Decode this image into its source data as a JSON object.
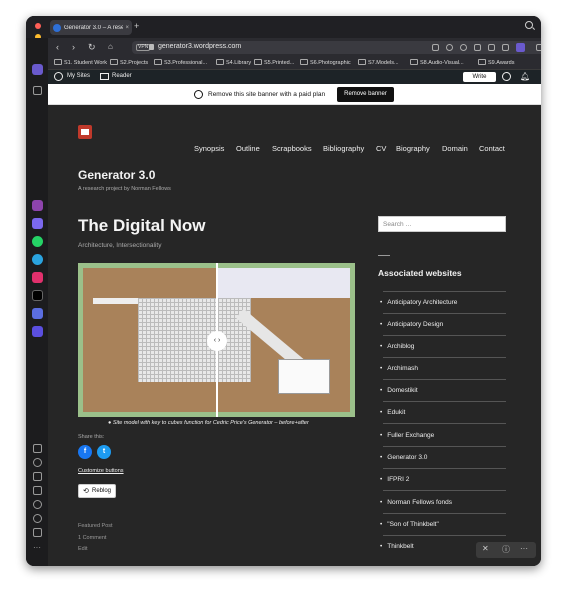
{
  "browser": {
    "tab_title": "Generator 3.0 – A resea",
    "new_tab": "+",
    "url": "generator3.wordpress.com",
    "vpn": "VPN",
    "bookmarks": [
      "S1. Student Work",
      "S2.Projects",
      "S3.Professional...",
      "S4.Library",
      "S5.Printed...",
      "S6.Photographic",
      "S7.Models...",
      "S8.Audio-Visual...",
      "S9.Awards"
    ]
  },
  "admin_bar": {
    "my_sites": "My Sites",
    "reader": "Reader",
    "write": "Write"
  },
  "banner": {
    "text": "Remove this site banner with a paid plan",
    "button": "Remove banner"
  },
  "site": {
    "menu": [
      "Synopsis",
      "Outline",
      "Scrapbooks",
      "Bibliography",
      "CV",
      "Biography",
      "Domain",
      "Contact"
    ],
    "title": "Generator 3.0",
    "tagline": "A research project by Norman Fellows"
  },
  "post": {
    "title": "The Digital Now",
    "categories": "Architecture, Intersectionality",
    "compare_handle": "‹ ›",
    "caption": "● Site model with key to cubes function for Cedric Price's Generator – before+after",
    "share_label": "Share this:",
    "customize": "Customize buttons",
    "reblog": "Reblog",
    "featured": "Featured Post",
    "comments": "1 Comment",
    "edit": "Edit"
  },
  "sidebar": {
    "search_placeholder": "Search …",
    "heading": "Associated websites",
    "links": [
      "Anticipatory Architecture",
      "Anticipatory Design",
      "Archiblog",
      "Archimash",
      "Domestikit",
      "Edukit",
      "Fuller Exchange",
      "Generator 3.0",
      "IFPRI 2",
      "Norman Fellows fonds",
      "\"Son of Thinkbelt\"",
      "Thinkbelt"
    ]
  },
  "colors": {
    "background": "#262626",
    "accent": "#2e6fd6",
    "brand": "#c0392b"
  }
}
